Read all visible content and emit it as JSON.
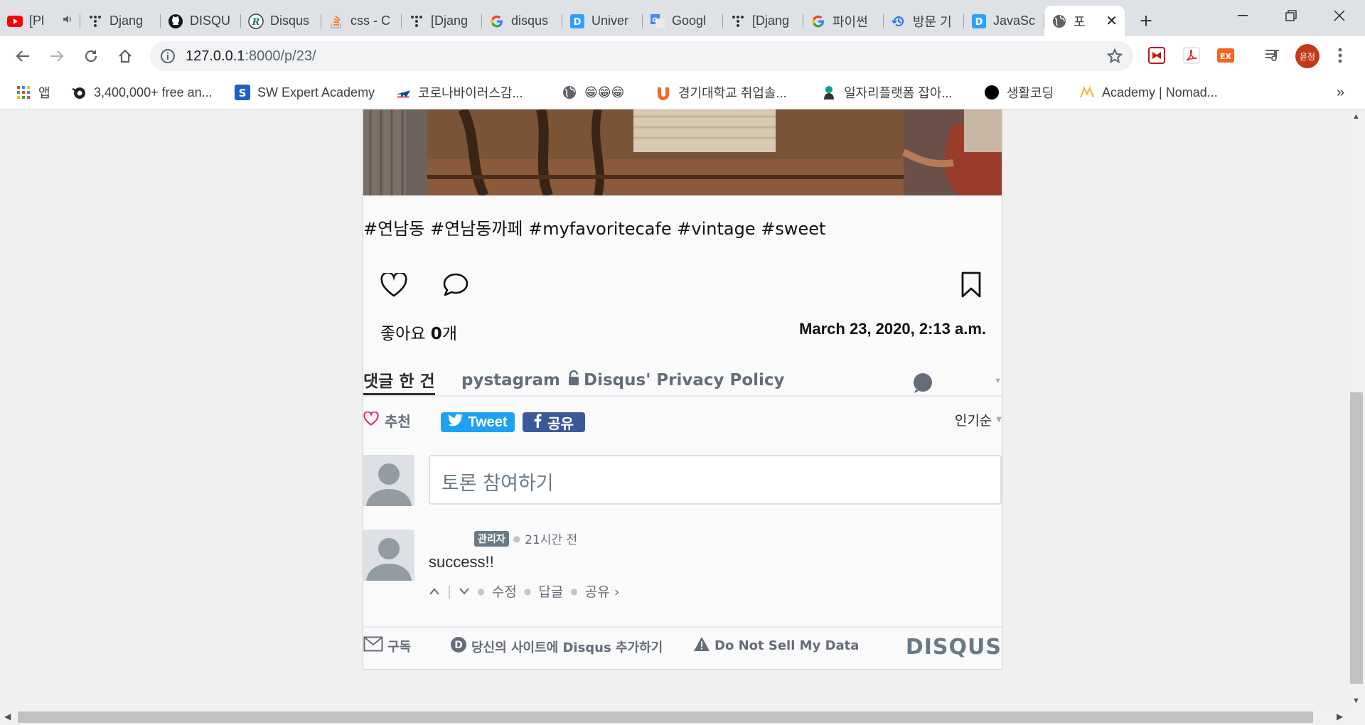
{
  "browser": {
    "tabs": [
      {
        "title": "[Pl",
        "icon": "youtube-icon",
        "muted": true
      },
      {
        "title": "Djang",
        "icon": "django-icon"
      },
      {
        "title": "DISQU",
        "icon": "github-icon"
      },
      {
        "title": "Disqus",
        "icon": "r-logo-icon"
      },
      {
        "title": "css - C",
        "icon": "stackoverflow-icon"
      },
      {
        "title": "[Djang",
        "icon": "django-icon"
      },
      {
        "title": "disqus",
        "icon": "google-icon"
      },
      {
        "title": "Univer",
        "icon": "disqus-icon"
      },
      {
        "title": "Googl",
        "icon": "translate-icon"
      },
      {
        "title": "[Djang",
        "icon": "django-icon"
      },
      {
        "title": "파이썬",
        "icon": "google-icon"
      },
      {
        "title": "방문 기",
        "icon": "history-icon"
      },
      {
        "title": "JavaSc",
        "icon": "disqus-icon"
      },
      {
        "title": "포",
        "icon": "globe-icon",
        "active": true
      }
    ],
    "address": {
      "host": "127.0.0.1",
      "path": ":8000/p/23/"
    },
    "profile_initials": "윤정",
    "bookmarks": [
      {
        "label": "앱",
        "icon": "apps-grid-icon"
      },
      {
        "label": "3,400,000+ free an...",
        "icon": "blender-icon"
      },
      {
        "label": "SW Expert Academy",
        "icon": "swea-icon"
      },
      {
        "label": "코로나바이러스감...",
        "icon": "plane-icon"
      },
      {
        "label": "😁😁😁",
        "icon": "globe-icon"
      },
      {
        "label": "경기대학교 취업솔...",
        "icon": "university-icon"
      },
      {
        "label": "일자리플랫폼 잡아...",
        "icon": "jobplatform-icon"
      },
      {
        "label": "생활코딩",
        "icon": "black-circle-icon"
      },
      {
        "label": "Academy | Nomad...",
        "icon": "nomad-icon"
      }
    ],
    "more_bookmarks": "»"
  },
  "post": {
    "hashtags": "#연남동 #연남동까페 #myfavoritecafe #vintage #sweet",
    "likes_prefix": "좋아요 ",
    "likes_count": "0",
    "likes_suffix": "개",
    "date": "March 23, 2020, 2:13 a.m."
  },
  "disqus": {
    "tabs": {
      "comments": "댓글 한 건",
      "community": "pystagram",
      "privacy": "Disqus' Privacy Policy"
    },
    "recommend": "추천",
    "tweet": "Tweet",
    "share_fb": "공유",
    "sort": "인기순",
    "compose_placeholder": "토론 참여하기",
    "comment": {
      "badge": "관리자",
      "time": "21시간 전",
      "text": "success!!",
      "edit": "수정",
      "reply": "답글",
      "share": "공유 ›"
    },
    "footer": {
      "subscribe": "구독",
      "add_disqus": "당신의 사이트에 Disqus 추가하기",
      "do_not_sell": "Do Not Sell My Data",
      "logo": "DISQUS"
    }
  },
  "colors": {
    "tweet": "#1da1f2",
    "facebook": "#3b5998",
    "heart": "#e0245e",
    "disqus_gray": "#687a86"
  }
}
